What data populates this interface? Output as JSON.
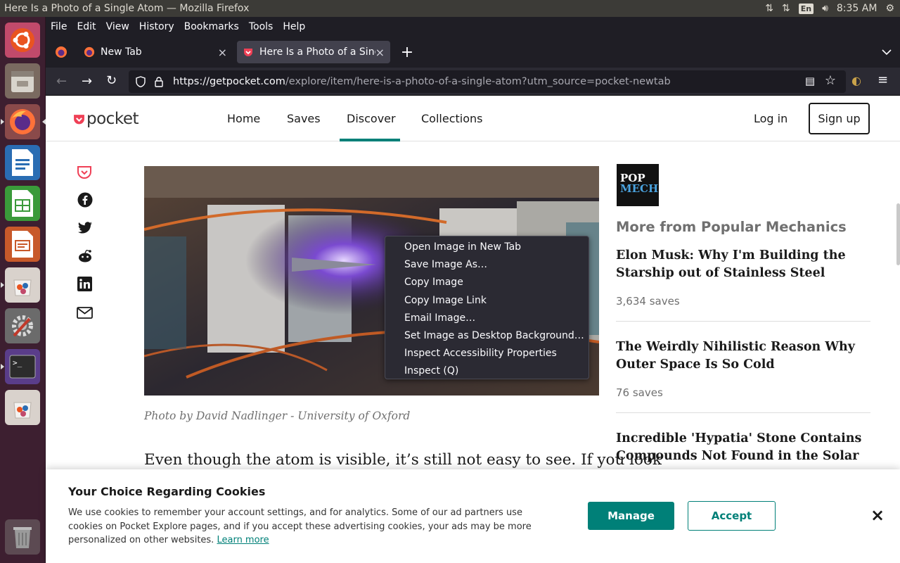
{
  "os": {
    "window_title": "Here Is a Photo of a Single Atom — Mozilla Firefox",
    "keyboard_lang": "En",
    "clock": "8:35 AM"
  },
  "launcher": {
    "items": [
      "Ubuntu",
      "Files",
      "Firefox",
      "LibreOffice Writer",
      "LibreOffice Calc",
      "LibreOffice Impress",
      "Ubuntu Software",
      "System Settings",
      "Terminal",
      "Ubuntu Software",
      "Trash"
    ]
  },
  "menubar": {
    "items": [
      "File",
      "Edit",
      "View",
      "History",
      "Bookmarks",
      "Tools",
      "Help"
    ]
  },
  "tabs": [
    {
      "label": "New Tab"
    },
    {
      "label": "Here Is a Photo of a Singl"
    }
  ],
  "url": {
    "domain": "https://getpocket.com",
    "path": "/explore/item/here-is-a-photo-of-a-single-atom?utm_source=pocket-newtab"
  },
  "pocket": {
    "logo": "pocket",
    "nav": [
      "Home",
      "Saves",
      "Discover",
      "Collections"
    ],
    "login": "Log in",
    "signup": "Sign up"
  },
  "article": {
    "caption": "Photo by David Nadlinger - University of Oxford",
    "body_line": "Even though the atom is visible, it’s still not easy to see. If you look"
  },
  "context_menu": {
    "items": [
      "Open Image in New Tab",
      "Save Image As…",
      "Copy Image",
      "Copy Image Link",
      "Email Image…",
      "Set Image as Desktop Background…",
      "Inspect Accessibility Properties",
      "Inspect (Q)"
    ]
  },
  "sidebar": {
    "publisher_logo_line1": "POP",
    "publisher_logo_line2": "MECH",
    "heading": "More from Popular Mechanics",
    "items": [
      {
        "title": "Elon Musk: Why I'm Building the Starship out of Stainless Steel",
        "saves": "3,634 saves"
      },
      {
        "title": "The Weirdly Nihilistic Reason Why Outer Space Is So Cold",
        "saves": "76 saves"
      },
      {
        "title": "Incredible 'Hypatia' Stone Contains Compounds Not Found in the Solar",
        "saves": ""
      }
    ]
  },
  "cookie": {
    "title": "Your Choice Regarding Cookies",
    "text": "We use cookies to remember your account settings, and for analytics. Some of our ad partners use cookies on Pocket Explore pages, and if you accept these advertising cookies, your ads may be more personalized on other websites.",
    "learn_more": "Learn more",
    "manage": "Manage",
    "accept": "Accept",
    "close": "×"
  },
  "colors": {
    "accent": "#008078",
    "pocket_red": "#ef4056",
    "launcher": "#3d1f30",
    "chrome": "#1f1e25"
  }
}
